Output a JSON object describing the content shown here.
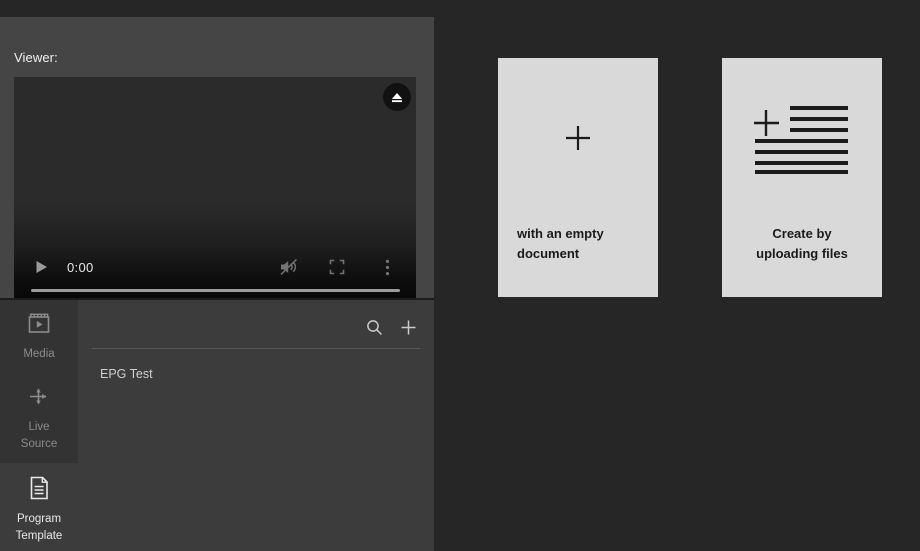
{
  "viewer": {
    "label": "Viewer:",
    "eject_icon": "eject-icon",
    "player": {
      "play_icon": "play-icon",
      "time": "0:00",
      "mute_icon": "volume-muted-icon",
      "fullscreen_icon": "fullscreen-icon",
      "more_icon": "more-vertical-icon",
      "progress_percent": 0
    }
  },
  "rail": {
    "items": [
      {
        "id": "media",
        "label": "Media",
        "icon": "film-play-icon",
        "active": false
      },
      {
        "id": "live-source",
        "label": "Live\nSource",
        "label_line1": "Live",
        "label_line2": "Source",
        "icon": "routing-arrow-icon",
        "active": false
      },
      {
        "id": "program-template",
        "label": "Program\nTemplate",
        "label_line1": "Program",
        "label_line2": "Template",
        "icon": "document-lines-icon",
        "active": true
      }
    ]
  },
  "list_panel": {
    "search_icon": "search-icon",
    "add_icon": "plus-icon",
    "rows": [
      {
        "label": "EPG Test"
      }
    ]
  },
  "cards": [
    {
      "id": "empty-document",
      "icon": "plus-icon",
      "text_line1": "with an empty",
      "text_line2": "document"
    },
    {
      "id": "upload-files",
      "icon": "plus-lines-icon",
      "text_line1": "Create by",
      "text_line2": "uploading files"
    }
  ],
  "colors": {
    "app_bg": "#262626",
    "viewer_panel": "#454545",
    "panel_bg": "#3c3c3c",
    "rail_bg": "#333333",
    "card_bg": "#d9d9d9",
    "text_light": "#e9e9e9",
    "text_muted": "#8c8c8c"
  }
}
